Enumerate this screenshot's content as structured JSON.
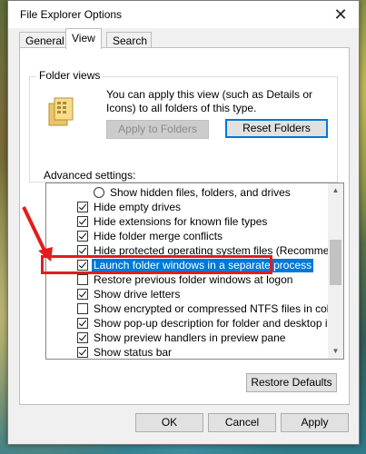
{
  "window": {
    "title": "File Explorer Options",
    "close_glyph": "✕"
  },
  "tabs": [
    {
      "label": "General"
    },
    {
      "label": "View"
    },
    {
      "label": "Search"
    }
  ],
  "folder_views": {
    "group_label": "Folder views",
    "description": "You can apply this view (such as Details or Icons) to all folders of this type.",
    "apply_button": "Apply to Folders",
    "reset_button": "Reset Folders"
  },
  "advanced": {
    "label": "Advanced settings:",
    "items": [
      {
        "type": "radio",
        "checked": false,
        "label": "Show hidden files, folders, and drives"
      },
      {
        "type": "checkbox",
        "checked": true,
        "label": "Hide empty drives"
      },
      {
        "type": "checkbox",
        "checked": true,
        "label": "Hide extensions for known file types"
      },
      {
        "type": "checkbox",
        "checked": true,
        "label": "Hide folder merge conflicts"
      },
      {
        "type": "checkbox",
        "checked": true,
        "label": "Hide protected operating system files (Recommended)"
      },
      {
        "type": "checkbox",
        "checked": true,
        "label": "Launch folder windows in a separate process",
        "selected": true
      },
      {
        "type": "checkbox",
        "checked": false,
        "label": "Restore previous folder windows at logon"
      },
      {
        "type": "checkbox",
        "checked": true,
        "label": "Show drive letters"
      },
      {
        "type": "checkbox",
        "checked": false,
        "label": "Show encrypted or compressed NTFS files in color"
      },
      {
        "type": "checkbox",
        "checked": true,
        "label": "Show pop-up description for folder and desktop items"
      },
      {
        "type": "checkbox",
        "checked": true,
        "label": "Show preview handlers in preview pane"
      },
      {
        "type": "checkbox",
        "checked": true,
        "label": "Show status bar"
      }
    ],
    "restore_defaults": "Restore Defaults"
  },
  "footer": {
    "ok": "OK",
    "cancel": "Cancel",
    "apply": "Apply"
  },
  "colors": {
    "accent": "#0078d7",
    "annotation": "#e31c1c"
  }
}
